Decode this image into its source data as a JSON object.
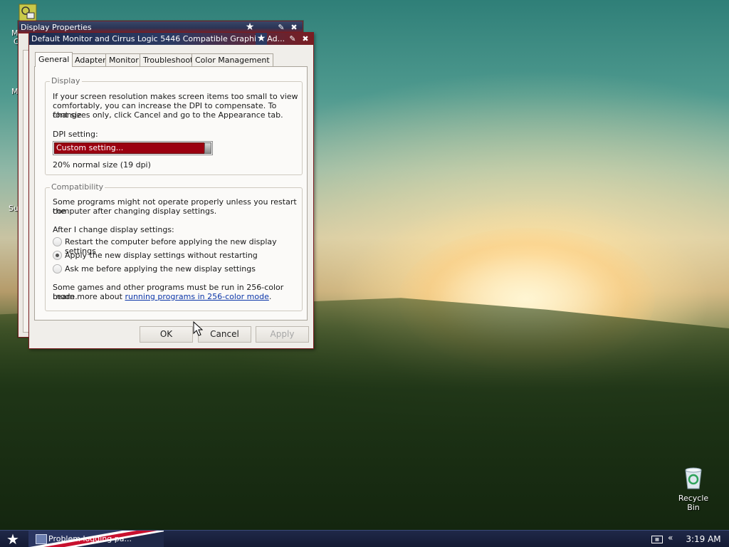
{
  "desktop": {
    "recycle_bin_label": "Recycle Bin",
    "partial_labels": [
      "M",
      "C",
      "M",
      "Su"
    ]
  },
  "back_window": {
    "title": "Display Properties"
  },
  "dialog": {
    "title": "Default Monitor and Cirrus Logic 5446 Compatible Graphics Ad...",
    "tabs": [
      {
        "label": "General",
        "active": true
      },
      {
        "label": "Adapter",
        "active": false
      },
      {
        "label": "Monitor",
        "active": false
      },
      {
        "label": "Troubleshoot",
        "active": false
      },
      {
        "label": "Color Management",
        "active": false
      }
    ],
    "display_group": {
      "title": "Display",
      "description_lines": [
        "If your screen resolution makes screen items too small to view",
        "comfortably, you can increase the DPI to compensate.  To change",
        "font sizes only, click Cancel and go to the Appearance tab."
      ],
      "dpi_label": "DPI setting:",
      "dpi_value": "Custom setting...",
      "dpi_note": "20% normal size (19 dpi)"
    },
    "compat_group": {
      "title": "Compatibility",
      "description_lines": [
        "Some programs might not operate properly unless you restart the",
        "computer after changing display settings."
      ],
      "after_label": "After I change display settings:",
      "options": [
        {
          "label": "Restart the computer before applying the new display settings",
          "checked": false
        },
        {
          "label": "Apply the new display settings without restarting",
          "checked": true
        },
        {
          "label": "Ask me before applying the new display settings",
          "checked": false
        }
      ],
      "footer_line1": "Some games and other programs must be run in 256-color mode.",
      "footer_prefix": "Learn more about ",
      "footer_link": "running programs in 256-color mode",
      "footer_suffix": "."
    },
    "buttons": {
      "ok": "OK",
      "cancel": "Cancel",
      "apply": "Apply"
    }
  },
  "taskbar": {
    "task_label": "Problem logging pa...",
    "clock": "3:19 AM"
  },
  "colors": {
    "title_navy": "#1f2c4f",
    "title_red": "#7a1d22",
    "dpi_highlight": "#9b0010",
    "taskbar": "#1f2848"
  }
}
